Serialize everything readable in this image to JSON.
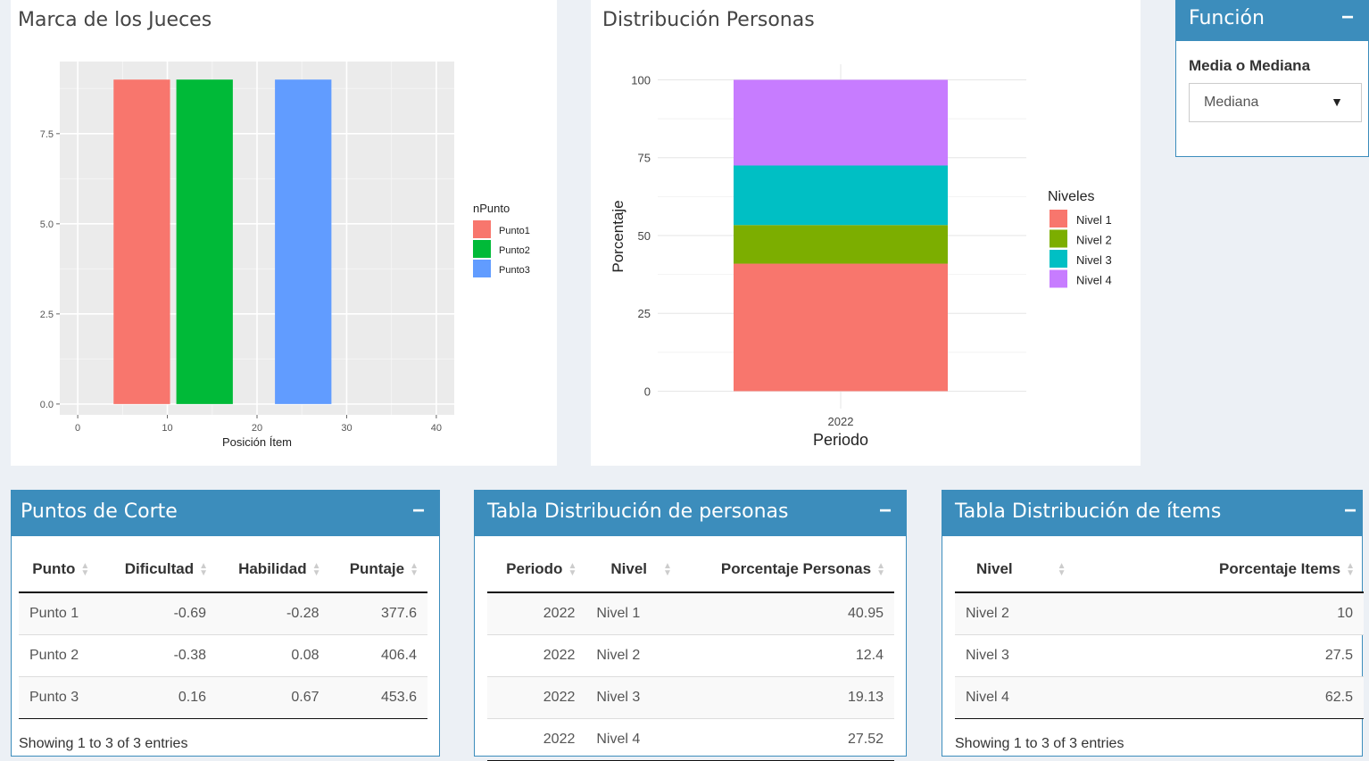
{
  "colors": {
    "accent": "#3c8dbc",
    "punto1": "#f8766d",
    "punto2": "#00ba38",
    "punto3": "#619cff",
    "nivel1": "#f8766d",
    "nivel2": "#7cae00",
    "nivel3": "#00bfc4",
    "nivel4": "#c77cff"
  },
  "plot1": {
    "title": "Marca de los Jueces",
    "chart_data": {
      "type": "bar",
      "xlabel": "Posición Ítem",
      "ylabel": "",
      "xlim": [
        -2,
        42
      ],
      "ylim": [
        -0.3,
        9.5
      ],
      "xticks": [
        "0",
        "10",
        "20",
        "30",
        "40"
      ],
      "yticks": [
        "0.0",
        "2.5",
        "5.0",
        "7.5"
      ],
      "legend_title": "nPunto",
      "legend_position": "right",
      "series": [
        {
          "name": "Punto1",
          "x": [
            4,
            10.3
          ],
          "value": 9,
          "color": "#f8766d"
        },
        {
          "name": "Punto2",
          "x": [
            11,
            17.3
          ],
          "value": 9,
          "color": "#00ba38"
        },
        {
          "name": "Punto3",
          "x": [
            22,
            28.3
          ],
          "value": 9,
          "color": "#619cff"
        }
      ]
    }
  },
  "plot2": {
    "title": "Distribución Personas",
    "chart_data": {
      "type": "bar",
      "stacked": true,
      "categories": [
        "2022"
      ],
      "xlabel": "Periodo",
      "ylabel": "Porcentaje",
      "ylim": [
        0,
        100
      ],
      "yticks": [
        "0",
        "25",
        "50",
        "75",
        "100"
      ],
      "legend_title": "Niveles",
      "legend_position": "right",
      "series": [
        {
          "name": "Nivel 1",
          "values": [
            40.95
          ],
          "color": "#f8766d"
        },
        {
          "name": "Nivel 2",
          "values": [
            12.4
          ],
          "color": "#7cae00"
        },
        {
          "name": "Nivel 3",
          "values": [
            19.13
          ],
          "color": "#00bfc4"
        },
        {
          "name": "Nivel 4",
          "values": [
            27.52
          ],
          "color": "#c77cff"
        }
      ]
    }
  },
  "funcion": {
    "title": "Función",
    "collapse": "−",
    "label": "Media o Mediana",
    "selected": "Mediana",
    "caret": "▼"
  },
  "puntos": {
    "title": "Puntos de Corte",
    "collapse": "−",
    "headers": [
      "Punto",
      "Dificultad",
      "Habilidad",
      "Puntaje"
    ],
    "rows": [
      [
        "Punto 1",
        "-0.69",
        "-0.28",
        "377.6"
      ],
      [
        "Punto 2",
        "-0.38",
        "0.08",
        "406.4"
      ],
      [
        "Punto 3",
        "0.16",
        "0.67",
        "453.6"
      ]
    ],
    "info": "Showing 1 to 3 of 3 entries"
  },
  "personas": {
    "title": "Tabla Distribución de personas",
    "collapse": "−",
    "headers": [
      "Periodo",
      "Nivel",
      "Porcentaje Personas"
    ],
    "rows": [
      [
        "2022",
        "Nivel 1",
        "40.95"
      ],
      [
        "2022",
        "Nivel 2",
        "12.4"
      ],
      [
        "2022",
        "Nivel 3",
        "19.13"
      ],
      [
        "2022",
        "Nivel 4",
        "27.52"
      ]
    ]
  },
  "items": {
    "title": "Tabla Distribución de ítems",
    "collapse": "−",
    "headers": [
      "Nivel",
      "Porcentaje Items"
    ],
    "rows": [
      [
        "Nivel 2",
        "10"
      ],
      [
        "Nivel 3",
        "27.5"
      ],
      [
        "Nivel 4",
        "62.5"
      ]
    ],
    "info": "Showing 1 to 3 of 3 entries"
  }
}
